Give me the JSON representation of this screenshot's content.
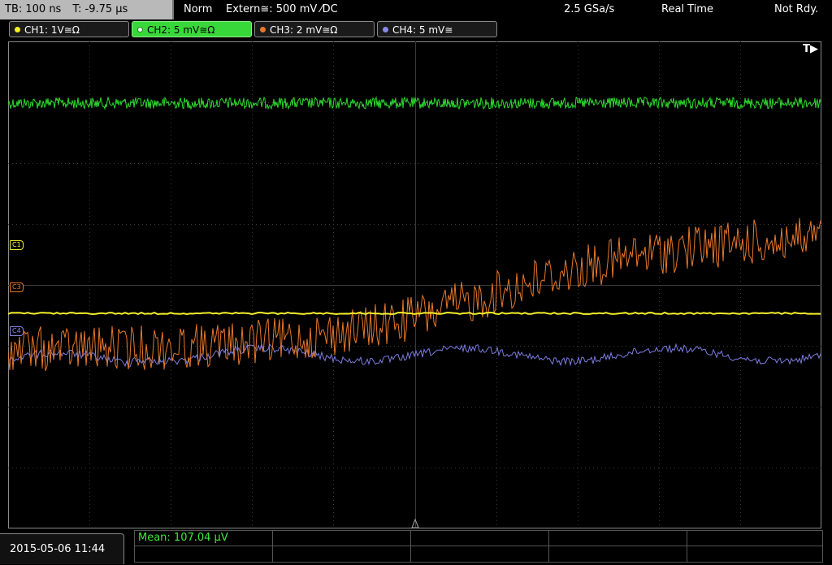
{
  "top_status": {
    "timebase": "TB: 100 ns",
    "trigger_time": "T: -9.75 µs",
    "mode": "Norm",
    "trigger_source": "Extern≅: 500 mV ⁄DC",
    "sample_rate": "2.5 GSa/s",
    "acq_mode": "Real Time",
    "state": "Not Rdy."
  },
  "channels": [
    {
      "label": "CH1: 1V≅Ω",
      "color": "#f5ef2a",
      "active": false
    },
    {
      "label": "CH2: 5 mV≅Ω",
      "color": "#39d83a",
      "active": true
    },
    {
      "label": "CH3: 2 mV≅Ω",
      "color": "#e8782a",
      "active": false
    },
    {
      "label": "CH4: 5 mV≅",
      "color": "#8a8ae6",
      "active": false
    }
  ],
  "markers": {
    "c1": "C1",
    "c3": "C3",
    "c4": "C4",
    "trigger": "T▶"
  },
  "bottom": {
    "datetime": "2015-05-06 11:44",
    "mean": "Mean: 107.04 µV"
  },
  "colors": {
    "ch1": "#f5ef2a",
    "ch2": "#2ed82e",
    "ch3": "#e8782a",
    "ch4": "#7c7ce0",
    "grid": "#3a3a3a"
  }
}
